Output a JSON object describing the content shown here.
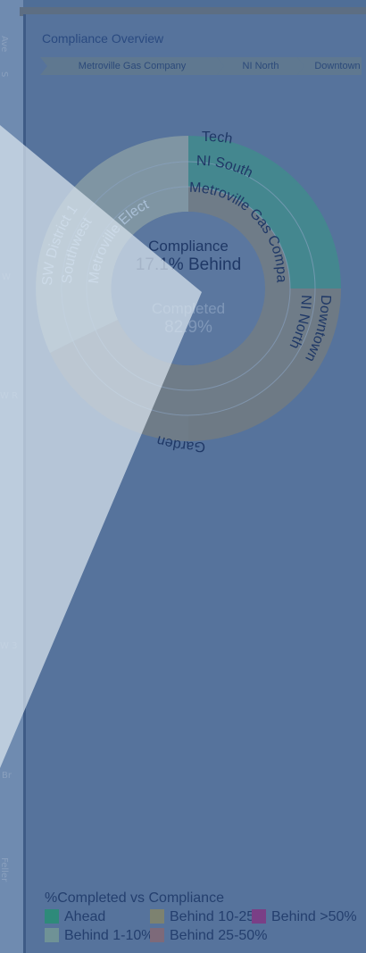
{
  "panel": {
    "title": "Compliance Overview"
  },
  "breadcrumb": [
    "Metroville Gas Company",
    "NI North",
    "Downtown"
  ],
  "map_labels": [
    "S Illinois",
    "Ave",
    "W",
    "W R",
    "Br",
    "Feller Rd",
    "W 3"
  ],
  "chart_data": {
    "type": "sunburst",
    "center": {
      "compliance_label": "Compliance",
      "compliance_value": "17.1% Behind",
      "completed_label": "Completed",
      "completed_value": "82.9%"
    },
    "rings": [
      {
        "level": "inner",
        "segments": [
          {
            "label": "Metroville Gas Company",
            "status": "Behind 10-25%"
          },
          {
            "label": "Metroville Elect",
            "status": "Behind 1-10%"
          }
        ]
      },
      {
        "level": "middle",
        "segments": [
          {
            "label": "NI South",
            "status": "Ahead"
          },
          {
            "label": "NI North",
            "status": "Behind 10-25%"
          },
          {
            "label": "Southwest",
            "status": "Behind 1-10%"
          }
        ]
      },
      {
        "level": "outer",
        "segments": [
          {
            "label": "Tech",
            "status": "Ahead"
          },
          {
            "label": "Downtown",
            "status": "Behind 10-25%"
          },
          {
            "label": "Garden",
            "status": "Behind 10-25%"
          },
          {
            "label": "SW District 1",
            "status": "Behind 1-10%"
          }
        ]
      }
    ],
    "legend_title": "%Completed vs Compliance",
    "legend": [
      {
        "label": "Ahead",
        "color": "#2e8a7a"
      },
      {
        "label": "Behind 1-10%",
        "color": "#6f9296"
      },
      {
        "label": "Behind 10-25%",
        "color": "#7d8270"
      },
      {
        "label": "Behind 25-50%",
        "color": "#7d6a7a"
      },
      {
        "label": "Behind >50%",
        "color": "#7a3f86"
      }
    ]
  },
  "colors": {
    "ahead": "#44878f",
    "behind_1_10": "#7f95a3",
    "behind_10_25": "#6f7c88",
    "panel_bg": "#56739c"
  }
}
